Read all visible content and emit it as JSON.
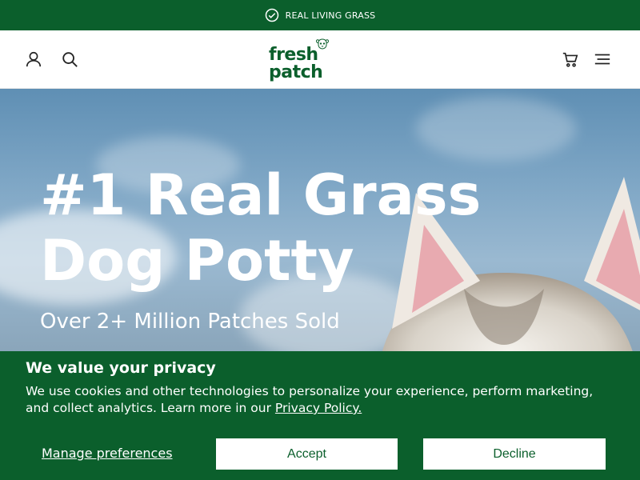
{
  "announcement": {
    "icon": "check-circle-icon",
    "text": "REAL LIVING GRASS"
  },
  "header": {
    "account_icon": "user-icon",
    "search_icon": "search-icon",
    "logo_text": "fresh patch",
    "cart_icon": "cart-icon",
    "menu_icon": "menu-icon"
  },
  "hero": {
    "title_line1": "#1 Real Grass",
    "title_line2": "Dog Potty",
    "subtitle": "Over 2+ Million Patches Sold"
  },
  "cookie": {
    "title": "We value your privacy",
    "body": "We use cookies and other technologies to personalize your experience, perform marketing, and collect analytics. Learn more in our ",
    "link": "Privacy Policy.",
    "manage_label": "Manage preferences",
    "accept_label": "Accept",
    "decline_label": "Decline"
  },
  "colors": {
    "brand_green": "#0b5f2c",
    "white": "#ffffff"
  }
}
